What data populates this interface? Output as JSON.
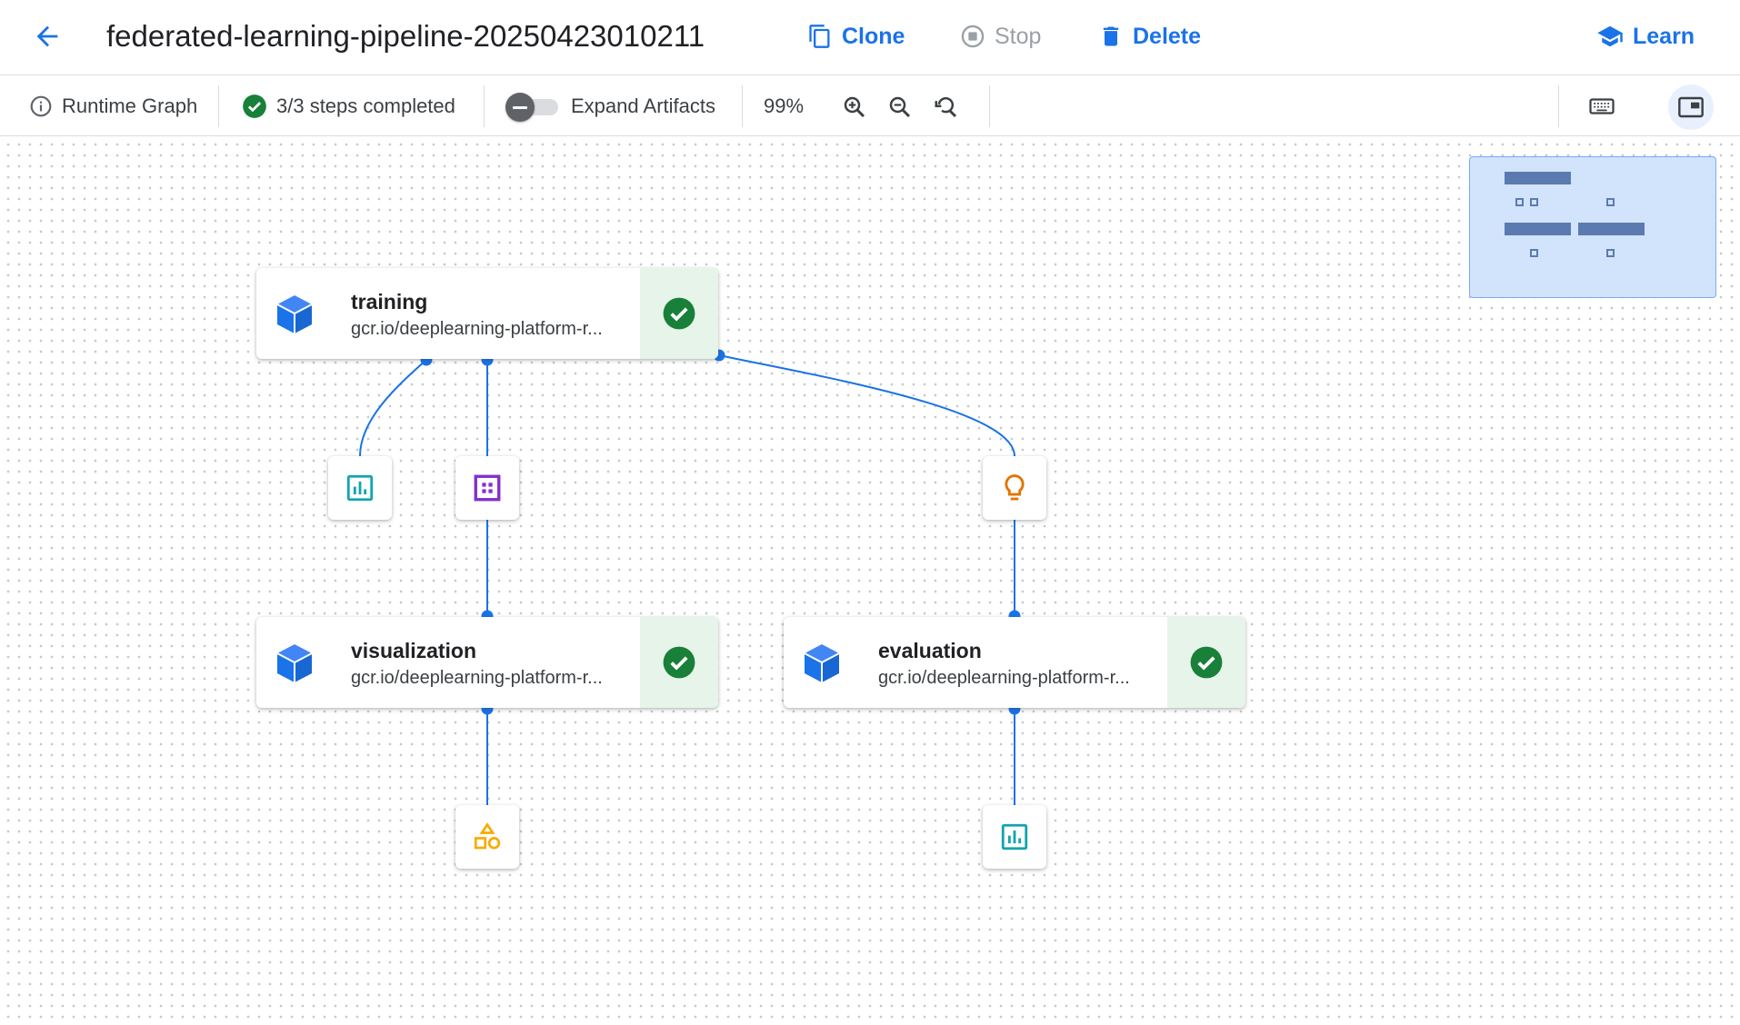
{
  "header": {
    "pipeline_title": "federated-learning-pipeline-20250423010211",
    "clone_label": "Clone",
    "stop_label": "Stop",
    "delete_label": "Delete",
    "learn_label": "Learn"
  },
  "toolbar": {
    "runtime_graph_label": "Runtime Graph",
    "steps_status": "3/3 steps completed",
    "expand_artifacts_label": "Expand Artifacts",
    "expand_artifacts_on": false,
    "zoom_level": "99%"
  },
  "nodes": [
    {
      "name": "training",
      "image": "gcr.io/deeplearning-platform-r...",
      "status": "succeeded"
    },
    {
      "name": "visualization",
      "image": "gcr.io/deeplearning-platform-r...",
      "status": "succeeded"
    },
    {
      "name": "evaluation",
      "image": "gcr.io/deeplearning-platform-r...",
      "status": "succeeded"
    }
  ],
  "artifacts": [
    {
      "type": "metrics-icon",
      "producer": "training"
    },
    {
      "type": "dataset-icon",
      "producer": "training"
    },
    {
      "type": "model-icon",
      "producer": "training"
    },
    {
      "type": "artifact-icon",
      "producer": "visualization"
    },
    {
      "type": "metrics-icon",
      "producer": "evaluation"
    }
  ],
  "colors": {
    "accent": "#1a73e8",
    "success": "#188038",
    "success_bg": "#e6f4ea",
    "metrics": "#12a4af",
    "dataset": "#8430ce",
    "model": "#e37400",
    "artifact": "#f9ab00",
    "edge": "#1a73e8"
  }
}
